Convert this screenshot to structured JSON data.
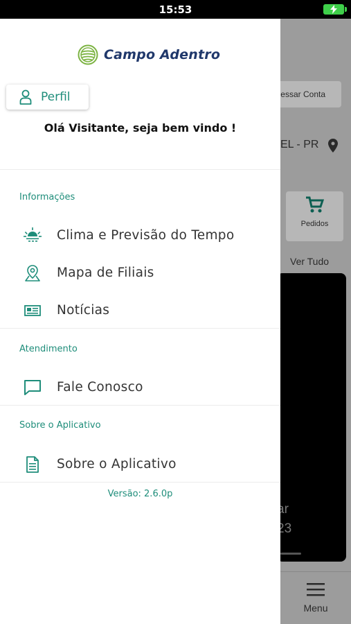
{
  "status_bar": {
    "time": "15:53"
  },
  "drawer": {
    "logo_text": "Campo Adentro",
    "profile_label": "Perfil",
    "greeting": "Olá Visitante, seja bem vindo !",
    "sections": [
      {
        "title": "Informações",
        "items": [
          {
            "label": "Clima e Previsão do Tempo",
            "icon": "weather-sun-icon"
          },
          {
            "label": "Mapa de Filiais",
            "icon": "map-pin-icon"
          },
          {
            "label": "Notícias",
            "icon": "newspaper-icon"
          }
        ]
      },
      {
        "title": "Atendimento",
        "items": [
          {
            "label": "Fale Conosco",
            "icon": "chat-icon"
          }
        ]
      },
      {
        "title": "Sobre o Aplicativo",
        "items": [
          {
            "label": "Sobre o Aplicativo",
            "icon": "document-icon"
          }
        ]
      }
    ],
    "version": "Versão: 2.6.0p"
  },
  "background": {
    "access_button": "essar Conta",
    "city": "EL - PR",
    "orders_label": "Pedidos",
    "see_all": "Ver Tudo",
    "card_text_1": "ar",
    "card_text_2": "23",
    "menu_label": "Menu"
  },
  "colors": {
    "accent": "#1e8d7a",
    "brand_navy": "#20386b",
    "logo_green": "#7cb342"
  }
}
